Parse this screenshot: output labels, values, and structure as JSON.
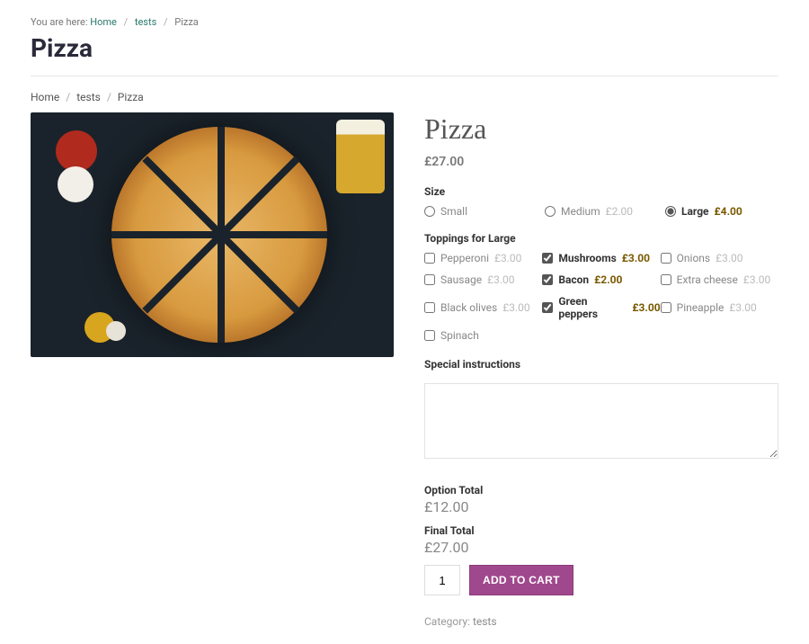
{
  "breadcrumb_top": {
    "prefix": "You are here:",
    "items": [
      "Home",
      "tests",
      "Pizza"
    ]
  },
  "page_title": "Pizza",
  "breadcrumb_wc": [
    "Home",
    "tests",
    "Pizza"
  ],
  "product": {
    "title": "Pizza",
    "base_price": "£27.00"
  },
  "size": {
    "label": "Size",
    "options": [
      {
        "name": "Small",
        "price": "",
        "selected": false
      },
      {
        "name": "Medium",
        "price": "£2.00",
        "selected": false
      },
      {
        "name": "Large",
        "price": "£4.00",
        "selected": true
      }
    ]
  },
  "toppings": {
    "label": "Toppings for Large",
    "options": [
      {
        "name": "Pepperoni",
        "price": "£3.00",
        "selected": false
      },
      {
        "name": "Mushrooms",
        "price": "£3.00",
        "selected": true
      },
      {
        "name": "Onions",
        "price": "£3.00",
        "selected": false
      },
      {
        "name": "Sausage",
        "price": "£3.00",
        "selected": false
      },
      {
        "name": "Bacon",
        "price": "£2.00",
        "selected": true
      },
      {
        "name": "Extra cheese",
        "price": "£3.00",
        "selected": false
      },
      {
        "name": "Black olives",
        "price": "£3.00",
        "selected": false
      },
      {
        "name": "Green peppers",
        "price": "£3.00",
        "selected": true
      },
      {
        "name": "Pineapple",
        "price": "£3.00",
        "selected": false
      },
      {
        "name": "Spinach",
        "price": "",
        "selected": false
      }
    ]
  },
  "special_instructions": {
    "label": "Special instructions",
    "value": ""
  },
  "totals": {
    "option_label": "Option Total",
    "option_value": "£12.00",
    "final_label": "Final Total",
    "final_value": "£27.00"
  },
  "cart": {
    "qty": "1",
    "button": "ADD TO CART"
  },
  "category": {
    "label": "Category:",
    "value": "tests"
  }
}
